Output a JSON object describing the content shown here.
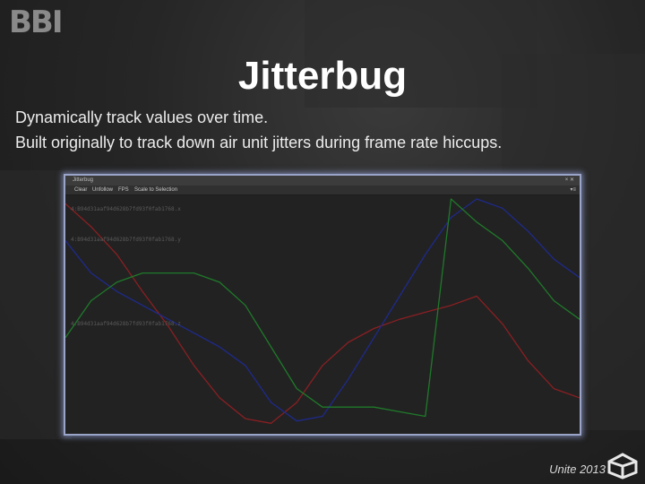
{
  "logo": {
    "text": "BBI"
  },
  "slide": {
    "title": "Jitterbug",
    "bullets": [
      "Dynamically track values over time.",
      "Built originally to track down air unit jitters during frame rate hiccups."
    ]
  },
  "window": {
    "title": "Jitterbug",
    "controls": "× ✕",
    "menu": "▾≡",
    "toolbar": {
      "clear": "Clear",
      "unfollow": "Unfollow",
      "fps": "FPS",
      "scale": "Scale to Selection"
    },
    "series_labels": [
      "4:B94d31aaf94d628b7fd93f0fab1768.x",
      "4:B94d31aaf94d628b7fd93f0fab1768.y",
      "4:B94d31aaf94d628b7fd93f0fab1768.z"
    ]
  },
  "footer": {
    "text": "Unite 2013"
  },
  "colors": {
    "red": "#8a1f22",
    "blue": "#1e2a8c",
    "green": "#1f7a2a"
  },
  "chart_data": {
    "type": "line",
    "x": [
      0,
      5,
      10,
      15,
      20,
      25,
      30,
      35,
      40,
      45,
      50,
      55,
      60,
      65,
      70,
      75,
      80,
      85,
      90,
      95,
      100
    ],
    "xlim": [
      0,
      100
    ],
    "ylim": [
      0,
      100
    ],
    "grid": false,
    "series": [
      {
        "name": "4:B94d31aaf94d628b7fd93f0fab1768.x",
        "color": "red",
        "values": [
          98,
          88,
          76,
          60,
          45,
          28,
          14,
          5,
          3,
          12,
          28,
          38,
          44,
          48,
          51,
          54,
          58,
          46,
          30,
          18,
          14
        ]
      },
      {
        "name": "4:B94d31aaf94d628b7fd93f0fab1768.y",
        "color": "blue",
        "values": [
          82,
          68,
          60,
          54,
          48,
          42,
          36,
          28,
          12,
          4,
          6,
          22,
          40,
          58,
          76,
          92,
          100,
          96,
          86,
          74,
          66
        ]
      },
      {
        "name": "4:B94d31aaf94d628b7fd93f0fab1768.z",
        "color": "green",
        "values": [
          40,
          56,
          64,
          68,
          68,
          68,
          64,
          54,
          36,
          18,
          10,
          10,
          10,
          8,
          6,
          100,
          90,
          82,
          70,
          56,
          48
        ]
      }
    ]
  }
}
